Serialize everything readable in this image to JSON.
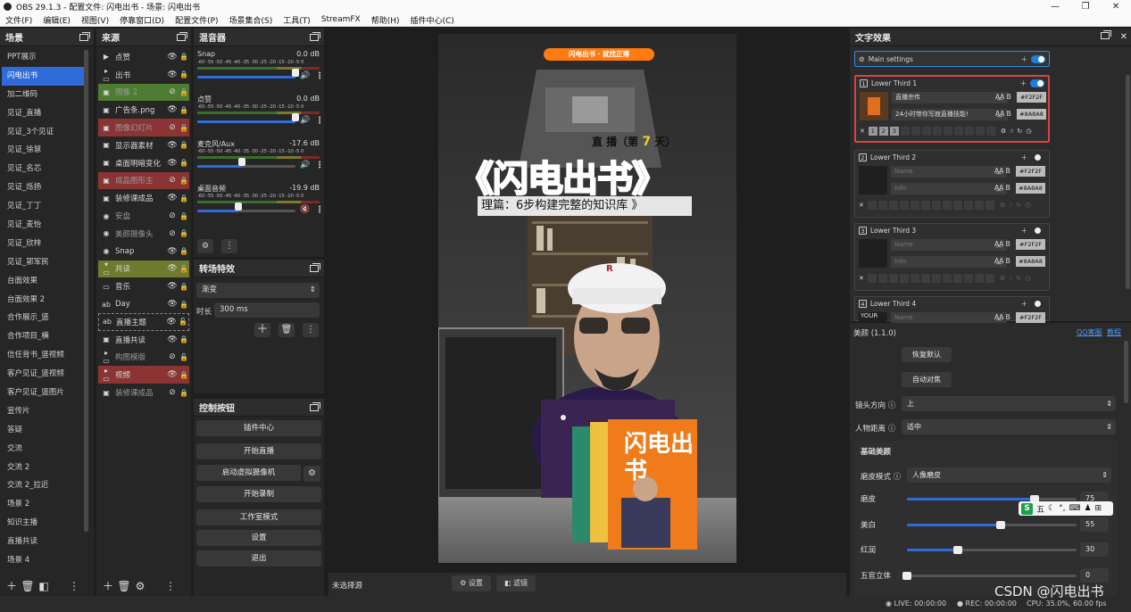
{
  "window": {
    "title": "OBS 29.1.3 - 配置文件: 闪电出书 - 场景: 闪电出书",
    "min": "—",
    "max": "❐",
    "close": "✕"
  },
  "menu": [
    "文件(F)",
    "编辑(E)",
    "视图(V)",
    "停靠窗口(D)",
    "配置文件(P)",
    "场景集合(S)",
    "工具(T)",
    "StreamFX",
    "帮助(H)",
    "插件中心(C)"
  ],
  "scenes": {
    "title": "场景",
    "items": [
      "PPT展示",
      "闪电出书",
      "加二维码",
      "见证_直播",
      "见证_3个见证",
      "见证_徐慧",
      "见证_名芯",
      "见证_烁扬",
      "见证_丁丁",
      "见证_麦怡",
      "见证_欣梓",
      "见证_郭军民",
      "台面效果",
      "台面效果 2",
      "合作展示_竖",
      "合作项目_横",
      "信任背书_竖视频",
      "客户见证_竖视频",
      "客户见证_竖图片",
      "宣传片",
      "答疑",
      "交流",
      "交流 2",
      "交流 2_拉近",
      "场景 2",
      "知识主播",
      "直播共读",
      "场景 4"
    ],
    "selected": 1
  },
  "sources": {
    "title": "来源",
    "items": [
      {
        "icon": "▶",
        "name": "点赞",
        "style": "",
        "hidden": false,
        "locked": true
      },
      {
        "icon": "▸ ▭",
        "name": "出书",
        "style": "",
        "hidden": false,
        "locked": true
      },
      {
        "icon": "▣",
        "name": "图像 2",
        "style": "green",
        "hidden": true,
        "locked": true
      },
      {
        "icon": "▣",
        "name": "广告条.png",
        "style": "",
        "hidden": false,
        "locked": true
      },
      {
        "icon": "▣",
        "name": "图像幻灯片",
        "style": "red",
        "hidden": true,
        "locked": true
      },
      {
        "icon": "▣",
        "name": "显示器素材",
        "style": "",
        "hidden": false,
        "locked": true
      },
      {
        "icon": "▣",
        "name": "桌面明暗变化",
        "style": "",
        "hidden": false,
        "locked": true
      },
      {
        "icon": "▣",
        "name": "成品图形主",
        "style": "red",
        "hidden": true,
        "locked": true
      },
      {
        "icon": "▣",
        "name": "装修课成品",
        "style": "",
        "hidden": false,
        "locked": true
      },
      {
        "icon": "◉",
        "name": "安盘",
        "style": "",
        "hidden": true,
        "locked": true
      },
      {
        "icon": "◉",
        "name": "美颜摄像头",
        "style": "",
        "hidden": true,
        "locked": true
      },
      {
        "icon": "◉",
        "name": "Snap",
        "style": "",
        "hidden": false,
        "locked": true
      },
      {
        "icon": "▾ ▭",
        "name": "共读",
        "style": "olive",
        "hidden": false,
        "locked": false
      },
      {
        "icon": "▭",
        "name": "音乐",
        "style": "",
        "hidden": false,
        "locked": true
      },
      {
        "icon": "ab",
        "name": "Day",
        "style": "",
        "hidden": false,
        "locked": true
      },
      {
        "icon": "ab",
        "name": "直播主题",
        "style": "dashed",
        "hidden": false,
        "locked": false
      },
      {
        "icon": "▣",
        "name": "直播共读",
        "style": "",
        "hidden": false,
        "locked": true
      },
      {
        "icon": "▸ ▭",
        "name": "构图模版",
        "style": "",
        "hidden": true,
        "locked": false
      },
      {
        "icon": "▸ ▭",
        "name": "视频",
        "style": "red",
        "hidden": false,
        "locked": true
      },
      {
        "icon": "▣",
        "name": "装修课成品",
        "style": "",
        "hidden": true,
        "locked": true
      }
    ]
  },
  "mixer": {
    "title": "混音器",
    "ticks": "-60 -55 -50 -45 -40 -35 -30 -25 -20 -15 -10 -5 0",
    "channels": [
      {
        "name": "Snap",
        "db": "0.0 dB",
        "level": 1.0,
        "muted": false
      },
      {
        "name": "点赞",
        "db": "0.0 dB",
        "level": 1.0,
        "muted": false
      },
      {
        "name": "麦克风/Aux",
        "db": "-17.6 dB",
        "level": 0.45,
        "muted": false
      },
      {
        "name": "桌面音频",
        "db": "-19.9 dB",
        "level": 0.42,
        "muted": true
      }
    ]
  },
  "transitions": {
    "title": "转场特效",
    "selected": "渐变",
    "duration_label": "时长",
    "duration_value": "300 ms"
  },
  "controls": {
    "title": "控制按钮",
    "buttons": [
      "插件中心",
      "开始直播",
      "启动虚拟摄像机",
      "开始录制",
      "工作室模式",
      "设置",
      "退出"
    ]
  },
  "preview": {
    "badge": "闪电出书 · 就找正博",
    "day_prefix": "直 播（第",
    "day_num": "7",
    "day_suffix": "天）",
    "headline": "《闪电出书》",
    "subtitle": "理篇：6步构建完整的知识库 》",
    "cap_letters": "R",
    "book_title": "闪电出书"
  },
  "filter_bar": {
    "no_source": "未选择源",
    "settings": "设置",
    "filters": "滤镜"
  },
  "text_effects": {
    "title": "文字效果",
    "main_settings": "Main settings",
    "cards": [
      {
        "num": "1",
        "name": "Lower Third 1",
        "on": true,
        "line1": "直播宗传",
        "line2": "24小时带你写寂直播技能!",
        "tag1": "#F2F2F",
        "tag2": "#8A8A8",
        "ph": false
      },
      {
        "num": "2",
        "name": "Lower Third 2",
        "on": false,
        "line1": "Name",
        "line2": "Info",
        "tag1": "#F2F2F",
        "tag2": "#8A8A8",
        "ph": true
      },
      {
        "num": "3",
        "name": "Lower Third 3",
        "on": false,
        "line1": "Name",
        "line2": "Info",
        "tag1": "#F2F2F",
        "tag2": "#8A8A8",
        "ph": true
      },
      {
        "num": "4",
        "name": "Lower Third 4",
        "on": false,
        "line1": "Name",
        "line2": "",
        "tag1": "#F2F2F",
        "tag2": "",
        "ph": true
      }
    ],
    "card4_thumb": "YOUR"
  },
  "beauty": {
    "title": "美颜 (1.1.0)",
    "link1": "QQ客服",
    "link2": "教程",
    "reset": "恢复默认",
    "auto_focus": "自动对焦",
    "camera_dir_label": "镜头方向",
    "camera_dir_value": "上",
    "distance_label": "人物距离",
    "distance_value": "适中",
    "section": "基础美颜",
    "smooth_mode_label": "磨皮模式",
    "smooth_mode_value": "人像磨皮",
    "sliders": [
      {
        "label": "磨皮",
        "value": 75
      },
      {
        "label": "美白",
        "value": 55
      },
      {
        "label": "红润",
        "value": 30
      },
      {
        "label": "五官立体",
        "value": 0
      }
    ],
    "ime": "五"
  },
  "status": {
    "live": "LIVE: 00:00:00",
    "rec": "REC: 00:00:00",
    "cpu": "CPU: 35.0%, 60.00 fps",
    "watermark": "CSDN @闪电出书"
  },
  "colors": {
    "accent": "#2f6bd9",
    "selected_card": "#d64545",
    "headline_orange": "#ff7a10"
  }
}
